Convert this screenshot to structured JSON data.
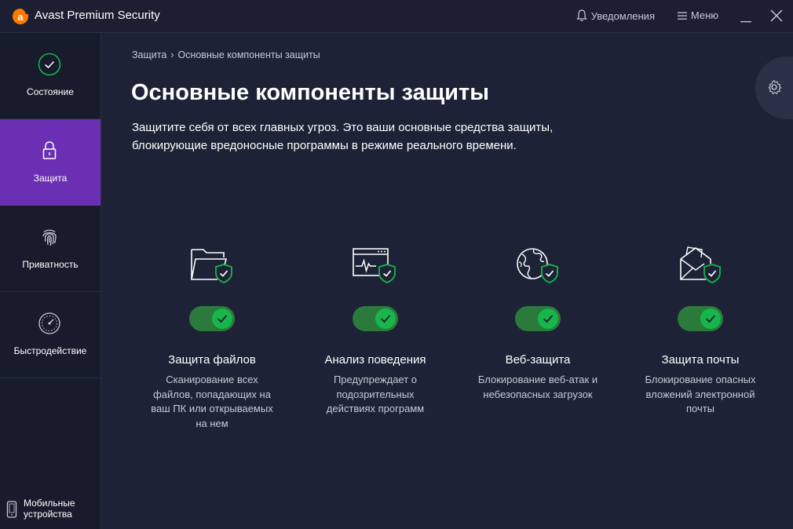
{
  "app": {
    "title": "Avast Premium Security",
    "accent": "#ff7800"
  },
  "titlebar": {
    "notifications_label": "Уведомления",
    "menu_label": "Меню"
  },
  "sidebar": {
    "items": [
      {
        "label": "Состояние",
        "icon": "status-check-icon"
      },
      {
        "label": "Защита",
        "icon": "lock-icon",
        "active": true
      },
      {
        "label": "Приватность",
        "icon": "fingerprint-icon"
      },
      {
        "label": "Быстродействие",
        "icon": "speedometer-icon"
      }
    ],
    "mobile_label_line1": "Мобильные",
    "mobile_label_line2": "устройства",
    "active_color": "#6b2fb3"
  },
  "main": {
    "breadcrumb": {
      "root": "Защита",
      "separator": "›",
      "current": "Основные компоненты защиты"
    },
    "title": "Основные компоненты защиты",
    "description": "Защитите себя от всех главных угроз. Это ваши основные средства защиты, блокирующие вредоносные программы в режиме реального времени.",
    "components": [
      {
        "title": "Защита файлов",
        "description": "Сканирование всех файлов, попадающих на ваш ПК или открываемых на нем",
        "icon": "folder-shield-icon",
        "enabled": true
      },
      {
        "title": "Анализ поведения",
        "description": "Предупреждает о подозрительных действиях программ",
        "icon": "behavior-monitor-icon",
        "enabled": true
      },
      {
        "title": "Веб-защита",
        "description": "Блокирование веб-атак и небезопасных загрузок",
        "icon": "globe-shield-icon",
        "enabled": true
      },
      {
        "title": "Защита почты",
        "description": "Блокирование опасных вложений электронной почты",
        "icon": "mail-shield-icon",
        "enabled": true
      }
    ]
  },
  "colors": {
    "background": "#1e2236",
    "sidebar": "#171b2c",
    "toggle_on": "#2b7a3b",
    "knob": "#16b64a",
    "shield_green": "#16b64a"
  }
}
